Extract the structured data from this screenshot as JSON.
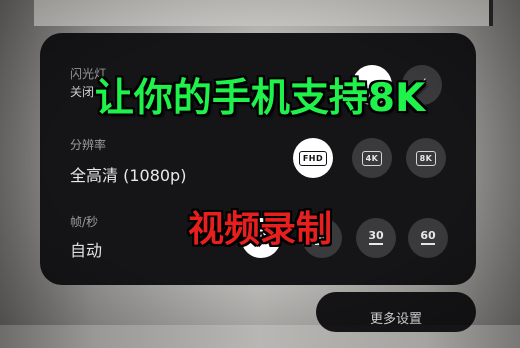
{
  "overlay": {
    "title": "让你的手机支持8K",
    "subtitle": "视频录制"
  },
  "settings": {
    "flash": {
      "label": "闪光灯",
      "value": "关闭"
    },
    "resolution": {
      "label": "分辨率",
      "value": "全高清 (1080p)",
      "options": [
        "FHD",
        "4K",
        "8K"
      ],
      "selected": "FHD"
    },
    "framerate": {
      "label": "帧/秒",
      "value": "自动",
      "options": [
        "30",
        "60"
      ]
    },
    "more_button": "更多设置"
  },
  "colors": {
    "panel": "#151517",
    "title_green": "#1ff24a",
    "subtitle_red": "#e81f1f"
  }
}
